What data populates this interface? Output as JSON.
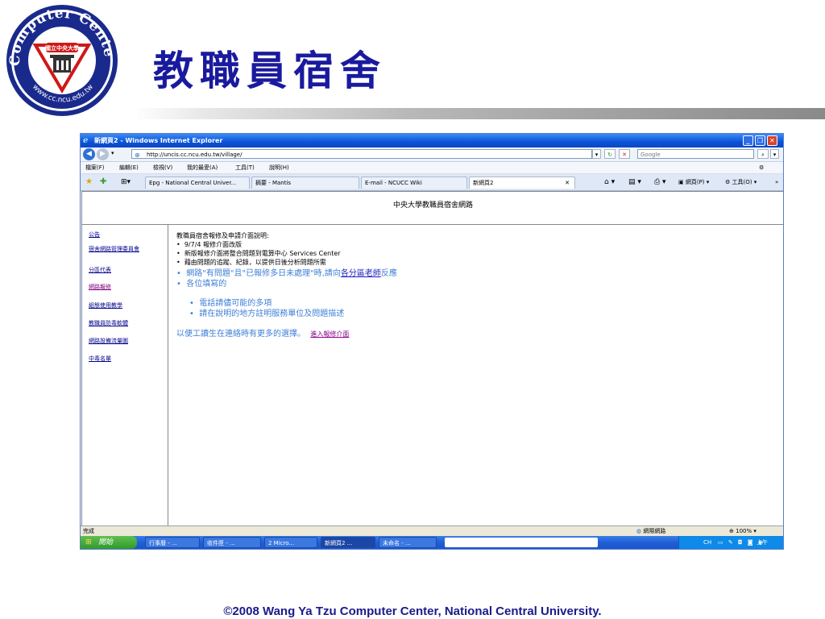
{
  "slide": {
    "title": "教職員宿舍",
    "footer": "©2008 Wang Ya Tzu Computer Center, National Central University.",
    "logo": {
      "ring_text": "Computer Center",
      "url_text": "www.cc.ncu.edu.tw",
      "badge_text": "國立中央大學"
    }
  },
  "browser": {
    "window_title": "新網頁2 - Windows Internet Explorer",
    "url": "http://uncis.cc.ncu.edu.tw/village/",
    "search_placeholder": "Google",
    "menu": [
      "檔案(F)",
      "編輯(E)",
      "檢視(V)",
      "我的最愛(A)",
      "工具(T)",
      "說明(H)"
    ],
    "tabs": [
      {
        "label": "Epg - National Central Univer..."
      },
      {
        "label": "摘要 - Mantis"
      },
      {
        "label": "E-mail - NCUCC Wiki"
      },
      {
        "label": "新網頁2",
        "active": true
      }
    ],
    "toolbar_right": {
      "page": "網頁(P)",
      "tools": "工具(O)"
    },
    "status": {
      "left": "完成",
      "zone": "網際網路",
      "zoom": "100%"
    },
    "taskbar": {
      "start": "開始",
      "tasks": [
        "行事曆 - ...",
        "收件匣 - ...",
        "2 Micro...",
        "新網頁2 ...",
        "未命名 - ..."
      ],
      "tray_lang": "CH",
      "clock": "上午 08:33"
    }
  },
  "page": {
    "header": "中央大學教職員宿舍網路",
    "sidebar": [
      {
        "label": "公告"
      },
      {
        "label": "宿舍網路管理委員會"
      },
      {
        "label": "分區代表"
      },
      {
        "label": "網路報修",
        "visited": true
      },
      {
        "label": "組態使用教學"
      },
      {
        "label": "教職員防毒軟體"
      },
      {
        "label": "網路設備流量圖"
      },
      {
        "label": "中毒名單"
      }
    ],
    "content": {
      "intro": "教職員宿舍報修及申請介面說明:",
      "bullets": [
        "9/7/4 報修介面改版",
        "新版報修介面將整合問題到電算中心 Services Center",
        "藉由問題的追蹤、紀錄，以提供日後分析問題所需"
      ],
      "blue_line_pre": "網路\"有問題\"且\"已報修多日未處理\"時,請向",
      "blue_line_link": "各分區老師",
      "blue_line_post": "反應",
      "blue_bullet2": "各位填寫的",
      "sub_bullets": [
        "電話請儘可能的多項",
        "請在說明的地方註明服務單位及問題描述"
      ],
      "closing": "以便工讀生在連絡時有更多的選擇。",
      "closing_link": "進入報修介面"
    }
  }
}
